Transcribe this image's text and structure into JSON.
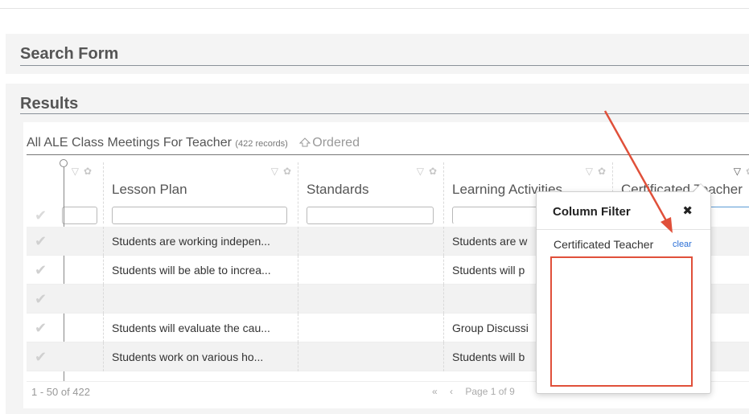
{
  "search_panel": {
    "title": "Search Form"
  },
  "results_panel": {
    "title": "Results"
  },
  "grid": {
    "caption": "All ALE Class Meetings For Teacher",
    "record_count": "(422 records)",
    "ordered_label": "Ordered",
    "columns": [
      {
        "label": "Lesson Plan"
      },
      {
        "label": "Standards"
      },
      {
        "label": "Learning Activities"
      },
      {
        "label": "Certificated Teacher"
      }
    ],
    "rows": [
      {
        "lesson_plan": "Students are working indepen...",
        "learning_activities": "Students are w"
      },
      {
        "lesson_plan": "Students will be able to increa...",
        "learning_activities": "Students will p"
      },
      {
        "lesson_plan": "",
        "learning_activities": ""
      },
      {
        "lesson_plan": "Students will evaluate the cau...",
        "learning_activities": "Group Discussi"
      },
      {
        "lesson_plan": "Students work on various ho...",
        "learning_activities": "Students will b"
      }
    ],
    "footer": {
      "range": "1 - 50 of 422",
      "page_label": "Page 1 of 9"
    }
  },
  "column_filter": {
    "title": "Column Filter",
    "close_glyph": "✖",
    "field_label": "Certificated Teacher",
    "clear_label": "clear"
  },
  "annotation": {
    "color": "#e0503a"
  }
}
